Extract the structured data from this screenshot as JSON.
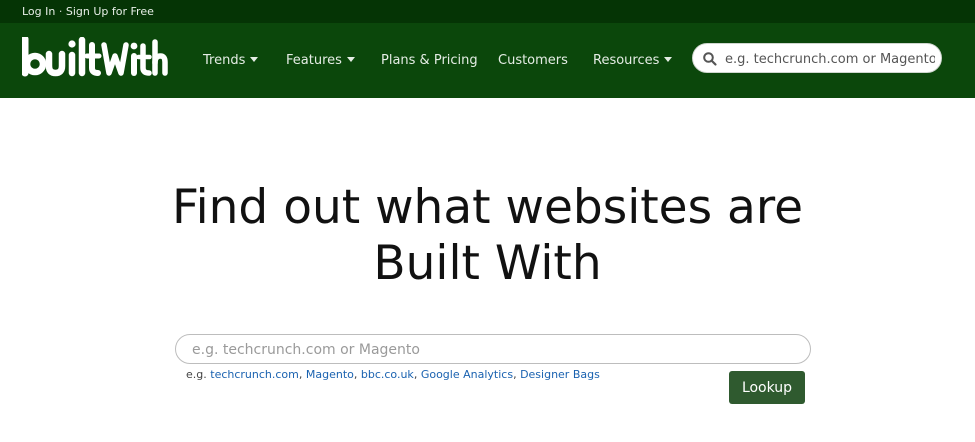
{
  "topbar": {
    "login": "Log In",
    "separator": " · ",
    "signup": "Sign Up for Free"
  },
  "brand": {
    "logo_text": "builtwith",
    "logo_color": "#ffffff"
  },
  "nav": {
    "trends": "Trends",
    "features": "Features",
    "plans": "Plans & Pricing",
    "customers": "Customers",
    "resources": "Resources"
  },
  "nav_search": {
    "placeholder": "e.g. techcrunch.com or Magento",
    "icon": "search-icon"
  },
  "hero": {
    "line1": "Find out what websites are",
    "line2": "Built With"
  },
  "main_search": {
    "placeholder": "e.g. techcrunch.com or Magento"
  },
  "examples": {
    "prefix": "e.g. ",
    "items": [
      "techcrunch.com",
      "Magento",
      "bbc.co.uk",
      "Google Analytics",
      "Designer Bags"
    ],
    "separator": ", "
  },
  "lookup": {
    "label": "Lookup"
  },
  "colors": {
    "topbar": "#053405",
    "navbar": "#0b470b",
    "button": "#2f5a2f",
    "link": "#1a62b0"
  }
}
